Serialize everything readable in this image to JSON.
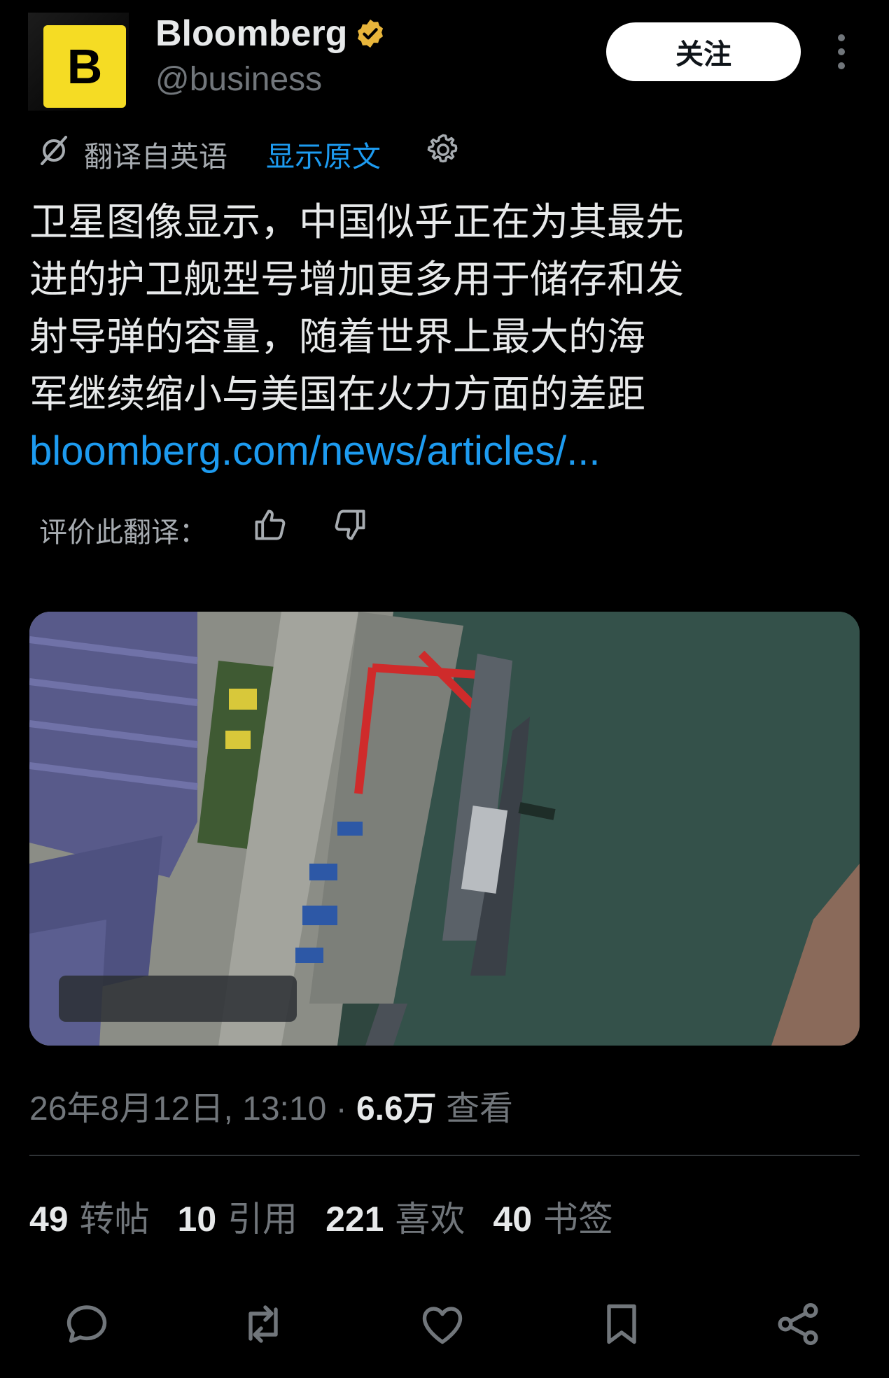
{
  "account": {
    "name": "Bloomberg",
    "handle": "@business",
    "avatar_letter": "B",
    "avatar_color": "#f5dc24",
    "verified_badge_color": "#e8b53b"
  },
  "header": {
    "follow_label": "关注"
  },
  "translation": {
    "translated_from": "翻译自英语",
    "show_original": "显示原文"
  },
  "tweet": {
    "lines": [
      "卫星图像显示，中国似乎正在为其最先",
      "进的护卫舰型号增加更多用于储存和发",
      "射导弹的容量，随着世界上最大的海",
      "军继续缩小与美国在火力方面的差距"
    ],
    "link": "bloomberg.com/news/articles/..."
  },
  "rating": {
    "label": "评价此翻译："
  },
  "meta": {
    "datetime": "26年8月12日, 13:10",
    "separator": " · ",
    "views_count": "6.6万",
    "views_label": " 查看"
  },
  "stats": [
    {
      "count": "49",
      "label": "转帖"
    },
    {
      "count": "10",
      "label": "引用"
    },
    {
      "count": "221",
      "label": "喜欢"
    },
    {
      "count": "40",
      "label": "书签"
    }
  ],
  "colors": {
    "background": "#000000",
    "text": "#e7e9ea",
    "secondary": "#71767b",
    "link": "#1d9bf0"
  },
  "icons": [
    "verified-badge-icon",
    "more-icon",
    "translate-icon",
    "gear-icon",
    "thumb-up-icon",
    "thumb-down-icon",
    "reply-icon",
    "repost-icon",
    "like-icon",
    "bookmark-icon",
    "share-icon"
  ]
}
